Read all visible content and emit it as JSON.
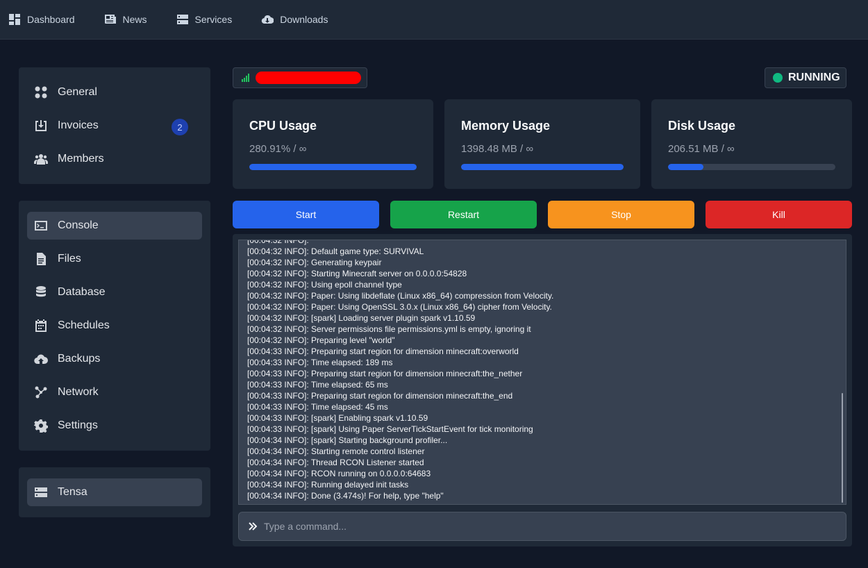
{
  "nav": [
    {
      "label": "Dashboard",
      "icon": "dashboard-icon"
    },
    {
      "label": "News",
      "icon": "newspaper-icon"
    },
    {
      "label": "Services",
      "icon": "server-icon"
    },
    {
      "label": "Downloads",
      "icon": "cloud-download-icon"
    }
  ],
  "sidebar": {
    "account": [
      {
        "label": "General",
        "icon": "grid-icon"
      },
      {
        "label": "Invoices",
        "icon": "inbox-download-icon",
        "badge": "2"
      },
      {
        "label": "Members",
        "icon": "users-icon"
      }
    ],
    "server": [
      {
        "label": "Console",
        "icon": "terminal-icon",
        "active": true
      },
      {
        "label": "Files",
        "icon": "file-icon"
      },
      {
        "label": "Database",
        "icon": "database-icon"
      },
      {
        "label": "Schedules",
        "icon": "calendar-icon"
      },
      {
        "label": "Backups",
        "icon": "cloud-upload-icon"
      },
      {
        "label": "Network",
        "icon": "network-icon"
      },
      {
        "label": "Settings",
        "icon": "gear-icon"
      }
    ],
    "node": {
      "label": "Tensa",
      "icon": "server-icon"
    }
  },
  "status": {
    "label": "RUNNING",
    "color": "#10b981"
  },
  "stats": {
    "cpu": {
      "title": "CPU Usage",
      "value": "280.91% / ∞",
      "fill_percent": 100
    },
    "memory": {
      "title": "Memory Usage",
      "value": "1398.48 MB / ∞",
      "fill_percent": 100
    },
    "disk": {
      "title": "Disk Usage",
      "value": "206.51 MB / ∞",
      "fill_percent": 21
    }
  },
  "controls": {
    "start": {
      "label": "Start",
      "color": "#2563eb"
    },
    "restart": {
      "label": "Restart",
      "color": "#16a34a"
    },
    "stop": {
      "label": "Stop",
      "color": "#f7931e"
    },
    "kill": {
      "label": "Kill",
      "color": "#dc2626"
    }
  },
  "console": {
    "lines": [
      "[00:04:32 INFO]: Default game type: SURVIVAL",
      "[00:04:32 INFO]: Generating keypair",
      "[00:04:32 INFO]: Starting Minecraft server on 0.0.0.0:54828",
      "[00:04:32 INFO]: Using epoll channel type",
      "[00:04:32 INFO]: Paper: Using libdeflate (Linux x86_64) compression from Velocity.",
      "[00:04:32 INFO]: Paper: Using OpenSSL 3.0.x (Linux x86_64) cipher from Velocity.",
      "[00:04:32 INFO]: [spark] Loading server plugin spark v1.10.59",
      "[00:04:32 INFO]: Server permissions file permissions.yml is empty, ignoring it",
      "[00:04:32 INFO]: Preparing level \"world\"",
      "[00:04:33 INFO]: Preparing start region for dimension minecraft:overworld",
      "[00:04:33 INFO]: Time elapsed: 189 ms",
      "[00:04:33 INFO]: Preparing start region for dimension minecraft:the_nether",
      "[00:04:33 INFO]: Time elapsed: 65 ms",
      "[00:04:33 INFO]: Preparing start region for dimension minecraft:the_end",
      "[00:04:33 INFO]: Time elapsed: 45 ms",
      "[00:04:33 INFO]: [spark] Enabling spark v1.10.59",
      "[00:04:33 INFO]: [spark] Using Paper ServerTickStartEvent for tick monitoring",
      "[00:04:34 INFO]: [spark] Starting background profiler...",
      "[00:04:34 INFO]: Starting remote control listener",
      "[00:04:34 INFO]: Thread RCON Listener started",
      "[00:04:34 INFO]: RCON running on 0.0.0.0:64683",
      "[00:04:34 INFO]: Running delayed init tasks",
      "[00:04:34 INFO]: Done (3.474s)! For help, type \"help\""
    ],
    "placeholder": "Type a command..."
  }
}
